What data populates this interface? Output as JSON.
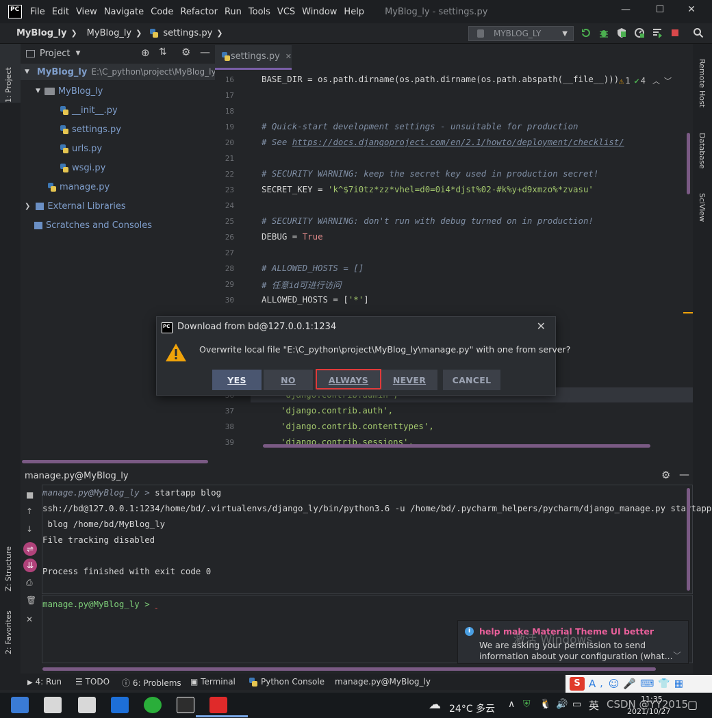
{
  "menubar": {
    "logo": "PC",
    "items": [
      "File",
      "Edit",
      "View",
      "Navigate",
      "Code",
      "Refactor",
      "Run",
      "Tools",
      "VCS",
      "Window",
      "Help"
    ],
    "window_title": "MyBlog_ly - settings.py"
  },
  "breadcrumb": [
    "MyBlog_ly",
    "MyBlog_ly",
    "settings.py"
  ],
  "run_config": "MYBLOG_LY",
  "left_tabs": [
    "1: Project",
    "Z: Structure",
    "2: Favorites"
  ],
  "right_tabs": [
    "Remote Host",
    "Database",
    "SciView"
  ],
  "project": {
    "header": "Project",
    "root_name": "MyBlog_ly",
    "root_path": "E:\\C_python\\project\\MyBlog_ly",
    "package": "MyBlog_ly",
    "files": [
      "__init__.py",
      "settings.py",
      "urls.py",
      "wsgi.py"
    ],
    "manage": "manage.py",
    "external": "External Libraries",
    "scratches": "Scratches and Consoles"
  },
  "editor": {
    "tab": "settings.py",
    "warnings": "1",
    "oks": "4",
    "line_numbers": [
      "16",
      "17",
      "18",
      "19",
      "20",
      "21",
      "22",
      "23",
      "24",
      "25",
      "26",
      "27",
      "28",
      "29",
      "30",
      "36",
      "37",
      "38",
      "39"
    ],
    "lines": {
      "l16": "BASE_DIR = os.path.dirname(os.path.dirname(os.path.abspath(__file__)))",
      "l19": "# Quick-start development settings - unsuitable for production",
      "l20a": "# See ",
      "l20b": "https://docs.djangoproject.com/en/2.1/howto/deployment/checklist/",
      "l22": "# SECURITY WARNING: keep the secret key used in production secret!",
      "l23a": "SECRET_KEY = ",
      "l23b": "'k^$7i0tz*zz*vhel=d0=0i4*djst%02-#k%y+d9xmzo%*zvasu'",
      "l25": "# SECURITY WARNING: don't run with debug turned on in production!",
      "l26a": "DEBUG = ",
      "l26b": "True",
      "l28": "# ALLOWED_HOSTS = []",
      "l29": "# 任意id可进行访问",
      "l30a": "ALLOWED_HOSTS = [",
      "l30b": "'*'",
      "l30c": "]",
      "l36": "'django.contrib.admin',",
      "l37": "'django.contrib.auth',",
      "l38": "'django.contrib.contenttypes',",
      "l39": "'django.contrib.sessions',"
    }
  },
  "dialog": {
    "title": "Download from bd@127.0.0.1:1234",
    "message": "Overwrite local file \"E:\\C_python\\project\\MyBlog_ly\\manage.py\" with one from server?",
    "buttons": [
      "YES",
      "NO",
      "ALWAYS",
      "NEVER",
      "CANCEL"
    ],
    "highlighted": "ALWAYS"
  },
  "run_panel": {
    "title": "manage.py@MyBlog_ly",
    "lines": {
      "c1_prompt": "manage.py@MyBlog_ly > ",
      "c1_cmd": "startapp blog",
      "c2": "ssh://bd@127.0.0.1:1234/home/bd/.virtualenvs/django_ly/bin/python3.6 -u /home/bd/.pycharm_helpers/pycharm/django_manage.py startapp",
      "c3": " blog /home/bd/MyBlog_ly",
      "c4": "File tracking disabled",
      "c5": "Process finished with exit code 0",
      "input_prompt": "manage.py@MyBlog_ly > "
    }
  },
  "notification": {
    "title": "help make Material Theme UI better",
    "body": "We are asking your permission to send information about your configuration (what...",
    "watermark": "激活 Windows"
  },
  "bottom_tabs": {
    "run": "4: Run",
    "todo": "TODO",
    "problems": "6: Problems",
    "terminal": "Terminal",
    "python_console": "Python Console",
    "active": "manage.py@MyBlog_ly"
  },
  "taskbar": {
    "weather": "24°C 多云",
    "ime": "英",
    "time": "11:35",
    "date": "2021/10/27",
    "watermark": "CSDN @YY2015"
  },
  "colors": {
    "accent": "#7a5fa8",
    "warning": "#f0a30a",
    "highlight_outline": "#e03a3a",
    "notif_title": "#e9609b"
  }
}
